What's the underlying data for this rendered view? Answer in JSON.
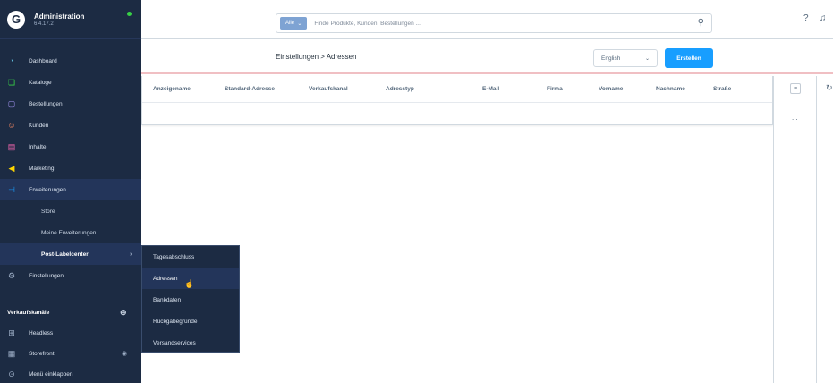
{
  "brand": {
    "name": "Administration",
    "version": "6.4.17.2"
  },
  "sidebar": {
    "items": [
      {
        "label": "Dashboard",
        "icon": "dashboard-icon",
        "color": "#5fb9d8"
      },
      {
        "label": "Kataloge",
        "icon": "catalog-icon",
        "color": "#37d046"
      },
      {
        "label": "Bestellungen",
        "icon": "orders-icon",
        "color": "#a092f0"
      },
      {
        "label": "Kunden",
        "icon": "customers-icon",
        "color": "#f88962"
      },
      {
        "label": "Inhalte",
        "icon": "content-icon",
        "color": "#ff68b4"
      },
      {
        "label": "Marketing",
        "icon": "marketing-icon",
        "color": "#ffd700"
      },
      {
        "label": "Erweiterungen",
        "icon": "extensions-icon",
        "color": "#189eff"
      }
    ],
    "subitems": [
      {
        "label": "Store"
      },
      {
        "label": "Meine Erweiterungen"
      },
      {
        "label": "Post-Labelcenter"
      }
    ],
    "settings": {
      "label": "Einstellungen",
      "icon": "settings-icon"
    },
    "section_title": "Verkaufskanäle",
    "channels": [
      {
        "label": "Headless",
        "icon": "headless-icon"
      },
      {
        "label": "Storefront",
        "icon": "storefront-icon"
      }
    ],
    "collapse_label": "Menü einklappen"
  },
  "search": {
    "filter_label": "Alle",
    "placeholder": "Finde Produkte, Kunden, Bestellungen ..."
  },
  "smartbar": {
    "breadcrumb": "Einstellungen > Adressen",
    "language": "English",
    "create_label": "Erstellen"
  },
  "grid": {
    "columns": [
      "Anzeigename",
      "Standard-Adresse",
      "Verkaufskanal",
      "Adresstyp",
      "E-Mail",
      "Firma",
      "Vorname",
      "Nachname",
      "Straße"
    ],
    "more_label": "...",
    "settings_label": "≡"
  },
  "flyout": {
    "items": [
      {
        "label": "Tagesabschluss"
      },
      {
        "label": "Adressen"
      },
      {
        "label": "Bankdaten"
      },
      {
        "label": "Rückgabegründe"
      },
      {
        "label": "Versandservices"
      }
    ]
  }
}
